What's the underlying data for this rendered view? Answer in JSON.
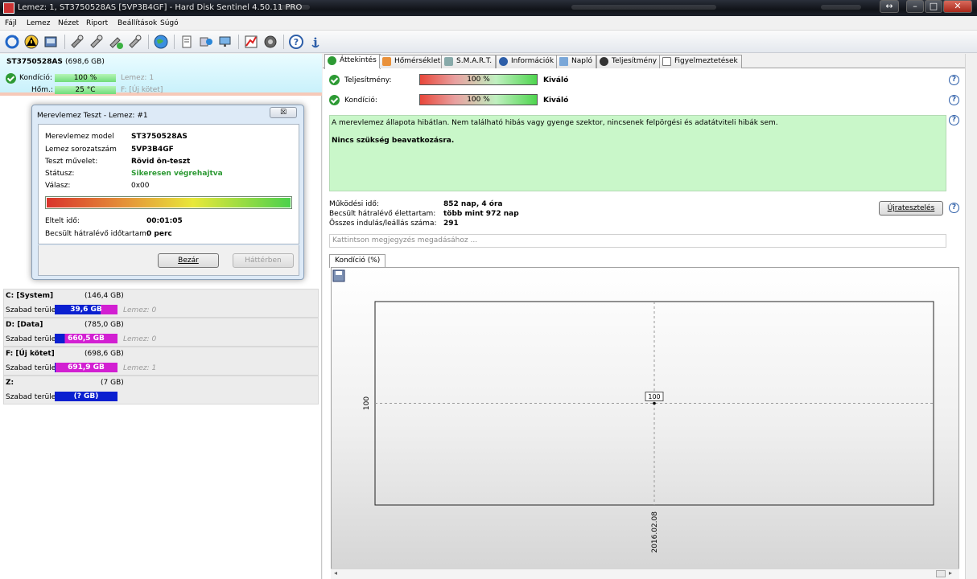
{
  "window": {
    "title": "Lemez: 1, ST3750528AS [5VP3B4GF]  -  Hard Disk Sentinel 4.50.11 PRO"
  },
  "menu": [
    {
      "label": "Fájl"
    },
    {
      "label": "Lemez"
    },
    {
      "label": "Nézet"
    },
    {
      "label": "Riport"
    },
    {
      "label": "Beállítások"
    },
    {
      "label": "Súgó"
    }
  ],
  "disk": {
    "model": "ST3750528AS",
    "size": "(698,6 GB)",
    "health_label": "Kondíció:",
    "health_value": "100 %",
    "health_disk": "Lemez: 1",
    "temp_label": "Hőm.:",
    "temp_value": "25 °C",
    "temp_volume": "F: [Új kötet]"
  },
  "dialog": {
    "title": "Merevlemez Teszt - Lemez: #1",
    "close_label": "☒",
    "rows": [
      {
        "label": "Merevlemez model",
        "value": "ST3750528AS"
      },
      {
        "label": "Lemez sorozatszám",
        "value": "5VP3B4GF"
      },
      {
        "label": "Teszt művelet:",
        "value": "Rövid ön-teszt"
      },
      {
        "label": "Státusz:",
        "value": "Sikeresen végrehajtva"
      },
      {
        "label": "Válasz:",
        "value": "0x00"
      }
    ],
    "progress": 1.0,
    "elapsed_label": "Eltelt idő:",
    "elapsed_value": "00:01:05",
    "remaining_label": "Becsült hátralévő időtartam:",
    "remaining_value": "0 perc",
    "close_button": "Bezár",
    "background_button": "Háttérben"
  },
  "volumes": [
    {
      "name": "C: [System]",
      "size": "(146,4 GB)",
      "free_label": "Szabad terület",
      "free": "39,6 GB",
      "free_fraction": 0.27,
      "disk": "Lemez: 0"
    },
    {
      "name": "D: [Data]",
      "size": "(785,0 GB)",
      "free_label": "Szabad terület",
      "free": "660,5 GB",
      "free_fraction": 0.84,
      "disk": "Lemez: 0"
    },
    {
      "name": "F: [Új kötet]",
      "size": "(698,6 GB)",
      "free_label": "Szabad terület",
      "free": "691,9 GB",
      "free_fraction": 0.99,
      "disk": "Lemez: 1"
    },
    {
      "name": "Z:",
      "size": "(7 GB)",
      "free_label": "Szabad terület",
      "free": "(? GB)",
      "free_fraction": 0.0,
      "disk": ""
    }
  ],
  "tabs": [
    {
      "label": "Áttekintés",
      "icon": "check-icon"
    },
    {
      "label": "Hőmérséklet",
      "icon": "thermometer-icon"
    },
    {
      "label": "S.M.A.R.T.",
      "icon": "smart-icon"
    },
    {
      "label": "Információk",
      "icon": "info-icon"
    },
    {
      "label": "Napló",
      "icon": "log-icon"
    },
    {
      "label": "Teljesítmény",
      "icon": "performance-icon"
    },
    {
      "label": "Figyelmeztetések",
      "icon": "alerts-icon"
    }
  ],
  "overview": {
    "performance_label": "Teljesítmény:",
    "performance_value": "100 %",
    "performance_rating": "Kiváló",
    "health_label": "Kondíció:",
    "health_value": "100 %",
    "health_rating": "Kiváló",
    "message": "A merevlemez állapota hibátlan. Nem található hibás vagy gyenge szektor, nincsenek felpörgési és adatátviteli hibák sem.",
    "advice": "Nincs szükség beavatkozásra.",
    "uptime_label": "Működési idő:",
    "uptime_value": "852 nap, 4 óra",
    "lifetime_label": "Becsült hátralévő élettartam:",
    "lifetime_value": "több mint 972 nap",
    "startstop_label": "Összes indulás/leállás száma:",
    "startstop_value": "291",
    "retest_button": "Újratesztelés",
    "comment_placeholder": "Kattintson megjegyzés megadásához ..."
  },
  "chart_tab": "Kondíció  (%)",
  "chart_data": {
    "type": "line",
    "x": [
      "2016.02.08"
    ],
    "series": [
      {
        "values": [
          100
        ]
      }
    ],
    "ylabel": "",
    "yticks": [
      "100"
    ],
    "data_labels": [
      "100"
    ],
    "grid": true
  },
  "colors": {
    "accent_green": "#2d9a34",
    "volume_blue": "#0a1fd0",
    "volume_magenta": "#d21fd2"
  }
}
